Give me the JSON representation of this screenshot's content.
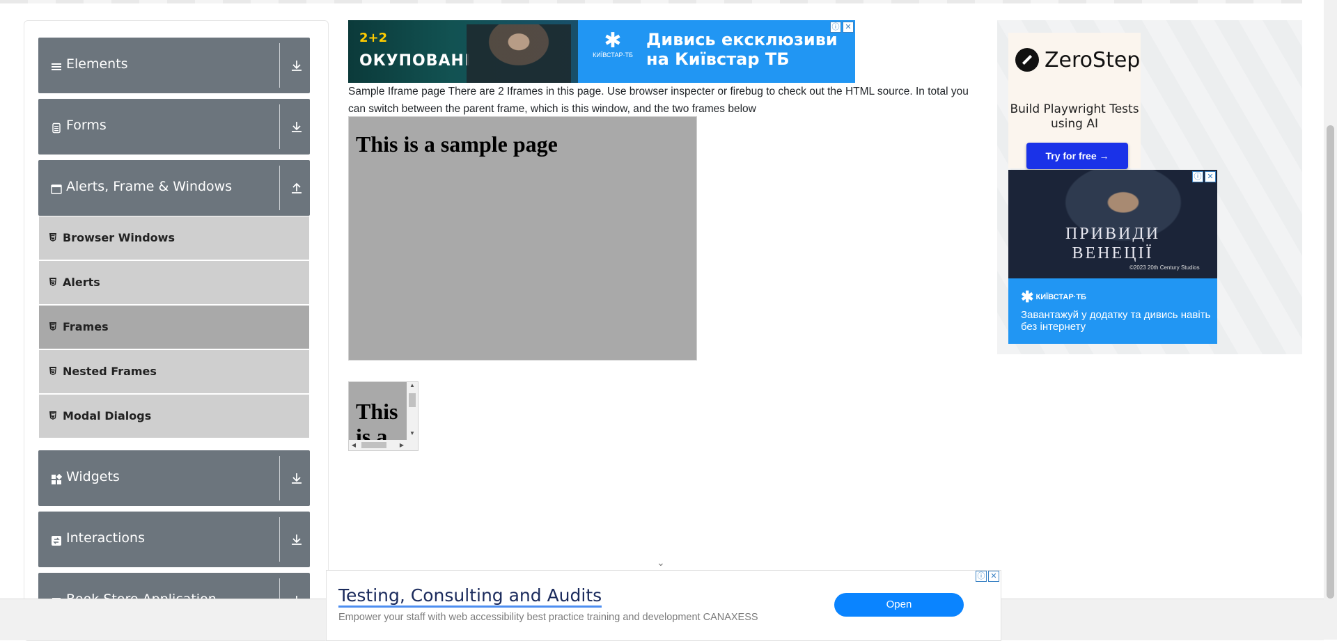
{
  "sidebar": {
    "groups": [
      {
        "title": "Elements",
        "icon": "list-icon",
        "arrow": "download-arrow-icon"
      },
      {
        "title": "Forms",
        "icon": "document-icon",
        "arrow": "download-arrow-icon"
      },
      {
        "title": "Alerts, Frame & Windows",
        "icon": "window-icon",
        "arrow": "upload-arrow-icon"
      },
      {
        "title": "Widgets",
        "icon": "widgets-icon",
        "arrow": "download-arrow-icon"
      },
      {
        "title": "Interactions",
        "icon": "interactions-icon",
        "arrow": "download-arrow-icon"
      },
      {
        "title": "Book Store Application",
        "icon": "book-icon",
        "arrow": "download-arrow-icon"
      }
    ],
    "items": [
      {
        "label": "Browser Windows"
      },
      {
        "label": "Alerts"
      },
      {
        "label": "Frames"
      },
      {
        "label": "Nested Frames"
      },
      {
        "label": "Modal Dialogs"
      }
    ]
  },
  "top_ad": {
    "logo": "2+2",
    "show": "ОКУПОВАНІ",
    "kyivstar": "КИЇВСТАР·ТБ",
    "tagline_1": "Дивись ексклюзиви",
    "tagline_2": "на Київстар ТБ"
  },
  "main": {
    "description": "Sample Iframe page There are 2 Iframes in this page. Use browser inspecter or firebug to check out the HTML source. In total you can switch between the parent frame, which is this window, and the two frames below",
    "frame1_heading": "This is a sample page",
    "frame2_heading": "This is a sample page"
  },
  "right_ad": {
    "brand": "ZeroStep",
    "subtitle": "Build Playwright Tests using AI",
    "cta": "Try for free →",
    "film_title_1": "ПРИВИДИ",
    "film_title_2": "ВЕНЕЦІЇ",
    "film_copyright": "©2023 20th Century Studios",
    "kyivstar": "КИЇВСТАР·ТБ",
    "film_text": "Завантажуй у додатку та дивись навіть без інтернету"
  },
  "bottom_ad": {
    "title": "Testing, Consulting and Audits",
    "text": "Empower your staff with web accessibility best practice training and development CANAXESS",
    "button": "Open"
  },
  "colors": {
    "group_header": "#6c757d",
    "item_bg": "#cfcfcf",
    "item_active_bg": "#a9a9a9",
    "frame_bg": "#a9a9a9",
    "open_button": "#0a84ff"
  }
}
